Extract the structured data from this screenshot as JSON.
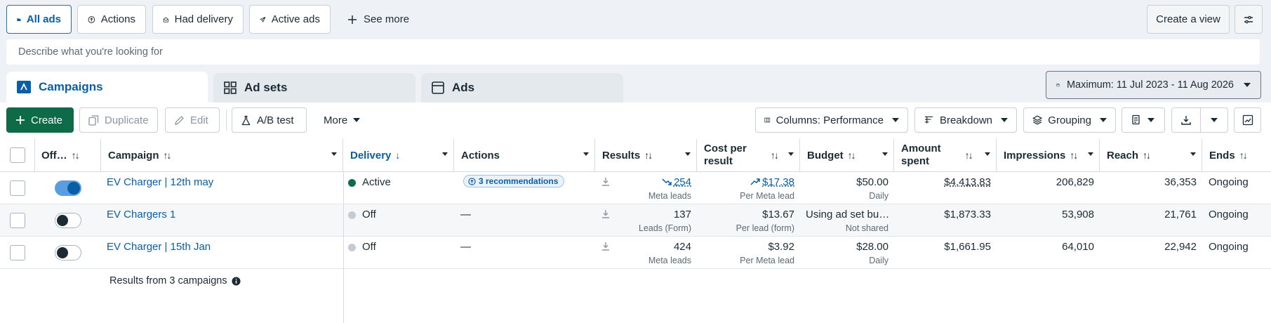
{
  "filters": {
    "all_ads": "All ads",
    "actions": "Actions",
    "had_delivery": "Had delivery",
    "active_ads": "Active ads",
    "see_more": "See more",
    "create_view": "Create a view"
  },
  "search": {
    "placeholder": "Describe what you're looking for"
  },
  "tabs": {
    "campaigns": "Campaigns",
    "ad_sets": "Ad sets",
    "ads": "Ads"
  },
  "date_range": "Maximum: 11 Jul 2023 - 11 Aug 2026",
  "toolbar": {
    "create": "Create",
    "duplicate": "Duplicate",
    "edit": "Edit",
    "ab_test": "A/B test",
    "more": "More",
    "columns": "Columns: Performance",
    "breakdown": "Breakdown",
    "grouping": "Grouping"
  },
  "columns": {
    "offon": "Off…",
    "campaign": "Campaign",
    "delivery": "Delivery",
    "actions": "Actions",
    "results": "Results",
    "cost_per_result_1": "Cost per",
    "cost_per_result_2": "result",
    "budget": "Budget",
    "amount_spent_1": "Amount",
    "amount_spent_2": "spent",
    "impressions": "Impressions",
    "reach": "Reach",
    "ends": "Ends"
  },
  "rows": [
    {
      "campaign": "EV Charger | 12th may",
      "toggle_on": true,
      "delivery": "Active",
      "delivery_color": "#0d6b47",
      "actions": "3 recommendations",
      "results": "254",
      "results_sub": "Meta leads",
      "cost": "$17.38",
      "cost_sub": "Per Meta lead",
      "budget": "$50.00",
      "budget_sub": "Daily",
      "spent": "$4,413.83",
      "impressions": "206,829",
      "reach": "36,353",
      "ends": "Ongoing"
    },
    {
      "campaign": "EV Chargers 1",
      "toggle_on": false,
      "delivery": "Off",
      "delivery_color": "#c4ccd3",
      "actions": "—",
      "results": "137",
      "results_sub": "Leads (Form)",
      "cost": "$13.67",
      "cost_sub": "Per lead (form)",
      "budget": "Using ad set bu…",
      "budget_sub": "Not shared",
      "spent": "$1,873.33",
      "impressions": "53,908",
      "reach": "21,761",
      "ends": "Ongoing"
    },
    {
      "campaign": "EV Charger | 15th Jan",
      "toggle_on": false,
      "delivery": "Off",
      "delivery_color": "#c4ccd3",
      "actions": "—",
      "results": "424",
      "results_sub": "Meta leads",
      "cost": "$3.92",
      "cost_sub": "Per Meta lead",
      "budget": "$28.00",
      "budget_sub": "Daily",
      "spent": "$1,661.95",
      "impressions": "64,010",
      "reach": "22,942",
      "ends": "Ongoing"
    }
  ],
  "summary": "Results from 3 campaigns",
  "colors": {
    "accent": "#0a5ea8",
    "primary_button": "#0d6b47",
    "active_dot": "#0d6b47",
    "off_dot": "#c4ccd3"
  }
}
